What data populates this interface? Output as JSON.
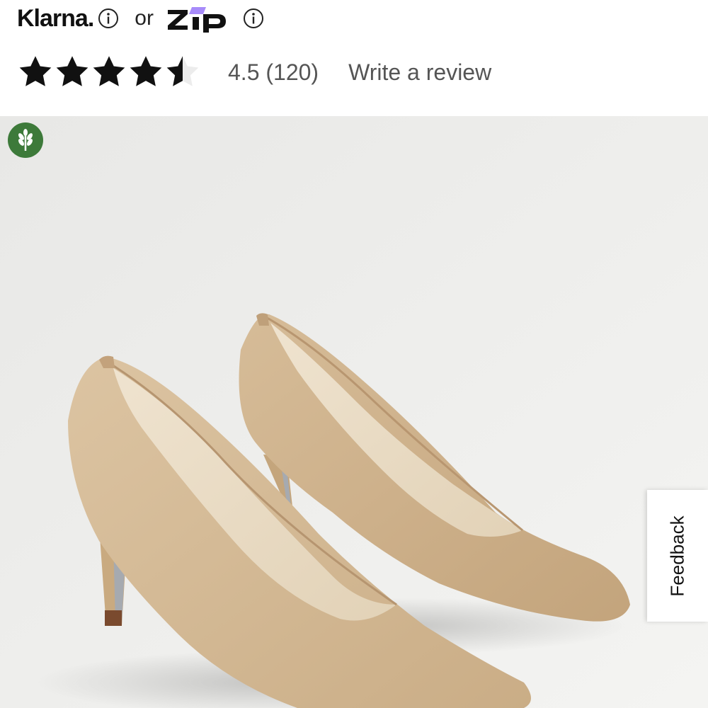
{
  "payment": {
    "klarna_label": "Klarna",
    "klarna_period": ".",
    "or_label": "or",
    "zip_label": "zip",
    "icons": [
      "info-circle-icon",
      "info-circle-icon"
    ]
  },
  "rating": {
    "stars_filled": 4.5,
    "stars_total": 5,
    "summary": "4.5 (120)",
    "write_review_label": "Write a review"
  },
  "product": {
    "image_subject": "nude-leather-pointed-toe-pumps",
    "badge_icon": "leaf-sustainability-icon",
    "badge_color": "#3d7a3a"
  },
  "feedback": {
    "label": "Feedback"
  },
  "colors": {
    "zip_accent": "#a78bfa",
    "star": "#111111",
    "text_muted": "#555555"
  }
}
